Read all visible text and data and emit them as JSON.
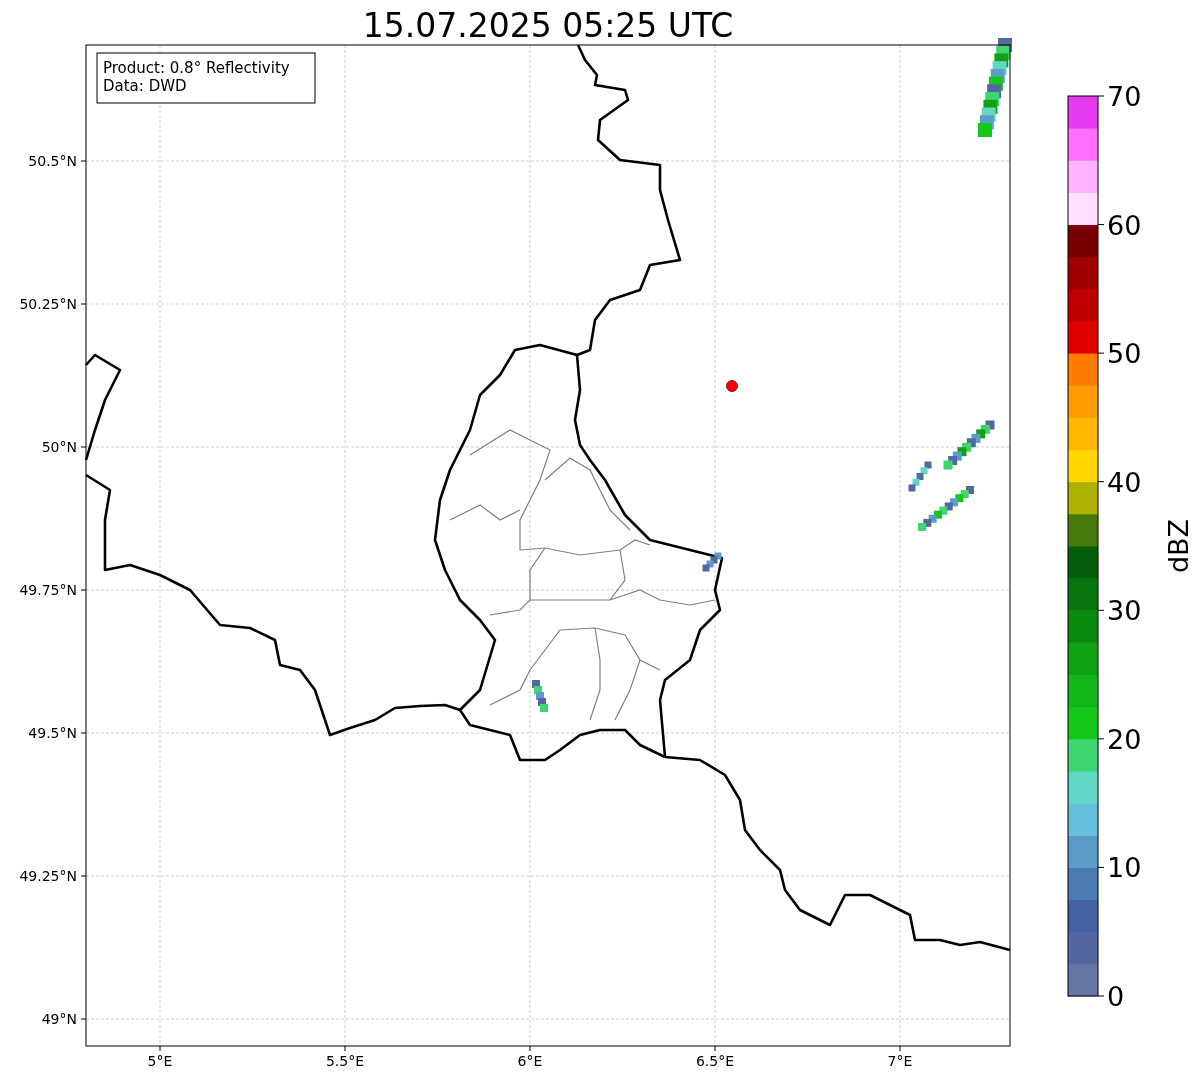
{
  "title": "15.07.2025 05:25 UTC",
  "legend": [
    "Product: 0.8° Reflectivity",
    "Data: DWD"
  ],
  "lat_ticks": [
    "50.5°N",
    "50.25°N",
    "50°N",
    "49.75°N",
    "49.5°N",
    "49.25°N",
    "49°N"
  ],
  "lon_ticks": [
    "5°E",
    "5.5°E",
    "6°E",
    "6.5°E",
    "7°E"
  ],
  "colorbar": {
    "label": "dBZ",
    "ticks": [
      "70",
      "60",
      "50",
      "40",
      "30",
      "20",
      "10",
      "0"
    ],
    "bins": [
      {
        "color": "#6674a6"
      },
      {
        "color": "#5567a0"
      },
      {
        "color": "#4560a3"
      },
      {
        "color": "#4b7ab3"
      },
      {
        "color": "#5b9cc8"
      },
      {
        "color": "#66c2dc"
      },
      {
        "color": "#63d6c6"
      },
      {
        "color": "#3ed66e"
      },
      {
        "color": "#13c818"
      },
      {
        "color": "#11b618"
      },
      {
        "color": "#0fa312"
      },
      {
        "color": "#0b8a10"
      },
      {
        "color": "#097510"
      },
      {
        "color": "#075e0b"
      },
      {
        "color": "#477a0b"
      },
      {
        "color": "#afb103"
      },
      {
        "color": "#ffd700"
      },
      {
        "color": "#ffb700"
      },
      {
        "color": "#ff9c00"
      },
      {
        "color": "#ff7c00"
      },
      {
        "color": "#e00000"
      },
      {
        "color": "#c00000"
      },
      {
        "color": "#a00000"
      },
      {
        "color": "#780000"
      },
      {
        "color": "#ffdfff"
      },
      {
        "color": "#ffb2ff"
      },
      {
        "color": "#ff6eff"
      },
      {
        "color": "#e63aef"
      }
    ]
  }
}
